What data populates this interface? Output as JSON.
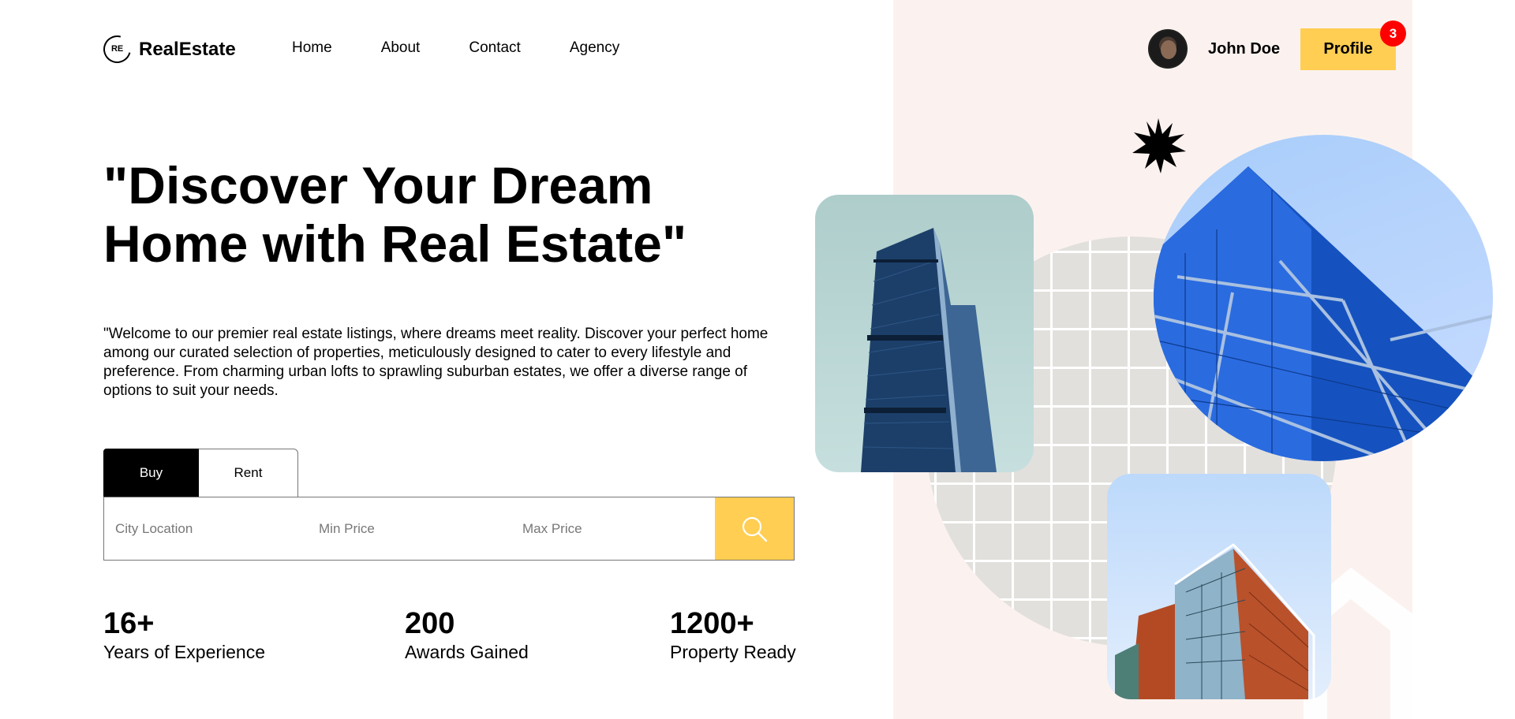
{
  "brand": {
    "logo_mark": "RE",
    "name": "RealEstate"
  },
  "nav": {
    "links": [
      "Home",
      "About",
      "Contact",
      "Agency"
    ]
  },
  "user": {
    "name": "John Doe",
    "profile_label": "Profile",
    "notification_count": "3"
  },
  "hero": {
    "title": "\"Discover Your Dream Home with Real Estate\"",
    "description": "\"Welcome to our premier real estate listings, where dreams meet reality. Discover your perfect home among our curated selection of properties, meticulously designed to cater to every lifestyle and preference. From charming urban lofts to sprawling suburban estates, we offer a diverse range of options to suit your needs."
  },
  "search": {
    "tabs": [
      "Buy",
      "Rent"
    ],
    "active_tab": "Buy",
    "city_placeholder": "City Location",
    "min_price_placeholder": "Min Price",
    "max_price_placeholder": "Max Price"
  },
  "stats": [
    {
      "value": "16+",
      "label": "Years of Experience"
    },
    {
      "value": "200",
      "label": "Awards Gained"
    },
    {
      "value": "1200+",
      "label": "Property Ready"
    }
  ],
  "colors": {
    "accent": "#ffce52",
    "badge": "#ff0000",
    "panel": "#fbf2ef",
    "primary": "#000000"
  },
  "icons": [
    "search-icon",
    "starburst-icon",
    "logo-icon"
  ]
}
